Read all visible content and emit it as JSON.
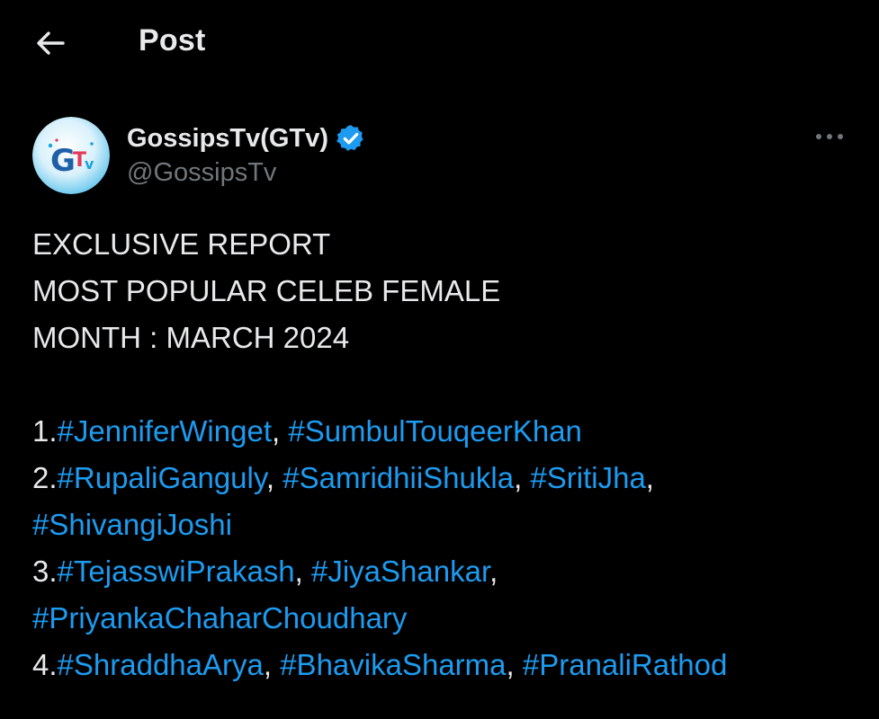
{
  "header": {
    "title": "Post",
    "back_icon": "arrow-left-icon"
  },
  "author": {
    "name": "GossipsTv(GTv)",
    "handle": "@GossipsTv",
    "avatar_text": "GTv",
    "verified": true,
    "verified_color": "#1d9bf0"
  },
  "more_icon": "more-horizontal-icon",
  "tweet": {
    "heading_lines": [
      "EXCLUSIVE REPORT",
      "MOST POPULAR CELEB FEMALE",
      "MONTH : MARCH 2024"
    ],
    "ranks": [
      {
        "prefix": "1.",
        "lines": [
          [
            "#JenniferWinget",
            "#SumbulTouqeerKhan"
          ]
        ]
      },
      {
        "prefix": "2.",
        "lines": [
          [
            "#RupaliGanguly",
            "#SamridhiiShukla",
            "#SritiJha,"
          ],
          [
            "#ShivangiJoshi"
          ]
        ]
      },
      {
        "prefix": "3.",
        "lines": [
          [
            "#TejasswiPrakash",
            "#JiyaShankar,"
          ],
          [
            "#PriyankaChaharChoudhary"
          ]
        ]
      },
      {
        "prefix": "4.",
        "lines": [
          [
            "#ShraddhaArya",
            "#BhavikaSharma",
            "#PranaliRathod"
          ]
        ]
      }
    ]
  },
  "colors": {
    "background": "#000000",
    "text": "#e7e9ea",
    "secondary_text": "#71767b",
    "link": "#1d9bf0"
  }
}
